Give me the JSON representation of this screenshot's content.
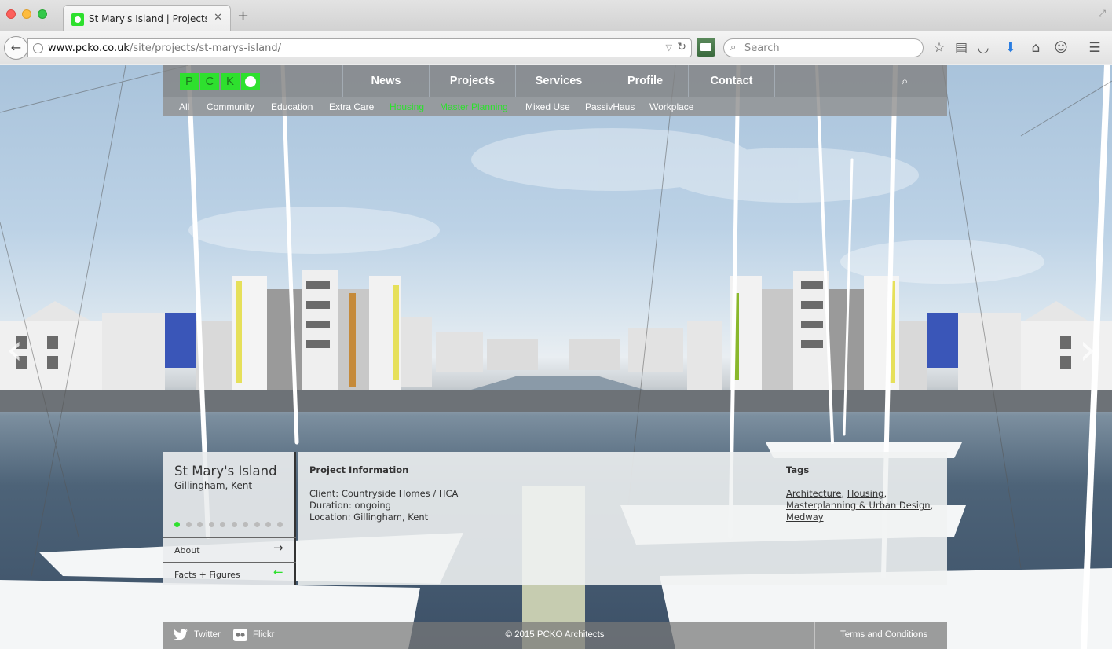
{
  "browser": {
    "tab_title": "St Mary's Island | Projects ...",
    "tab_close": "✕",
    "new_tab": "+",
    "url_domain": "www.pcko.co.uk",
    "url_path": "/site/projects/st-marys-island/",
    "search_placeholder": "Search"
  },
  "site": {
    "logo_letters": [
      "P",
      "C",
      "K"
    ],
    "nav": [
      "News",
      "Projects",
      "Services",
      "Profile",
      "Contact"
    ],
    "subnav": [
      {
        "label": "All",
        "active": false
      },
      {
        "label": "Community",
        "active": false
      },
      {
        "label": "Education",
        "active": false
      },
      {
        "label": "Extra Care",
        "active": false
      },
      {
        "label": "Housing",
        "active": true
      },
      {
        "label": "Master Planning",
        "active": true
      },
      {
        "label": "Mixed Use",
        "active": false
      },
      {
        "label": "PassivHaus",
        "active": false
      },
      {
        "label": "Workplace",
        "active": false
      }
    ],
    "accent_color": "#2ee02e"
  },
  "project": {
    "title": "St Mary's Island",
    "location": "Gillingham, Kent",
    "slides_total": 10,
    "slide_current": 1,
    "about_label": "About",
    "facts_label": "Facts + Figures",
    "info_heading": "Project Information",
    "client": "Client: Countryside Homes / HCA",
    "duration": "Duration: ongoing",
    "location_line": "Location: Gillingham, Kent",
    "tags_heading": "Tags",
    "tags": [
      "Architecture",
      "Housing",
      "Masterplanning & Urban Design",
      "Medway"
    ]
  },
  "footer": {
    "twitter": "Twitter",
    "flickr": "Flickr",
    "copyright": "© 2015 PCKO Architects",
    "terms": "Terms and Conditions"
  }
}
